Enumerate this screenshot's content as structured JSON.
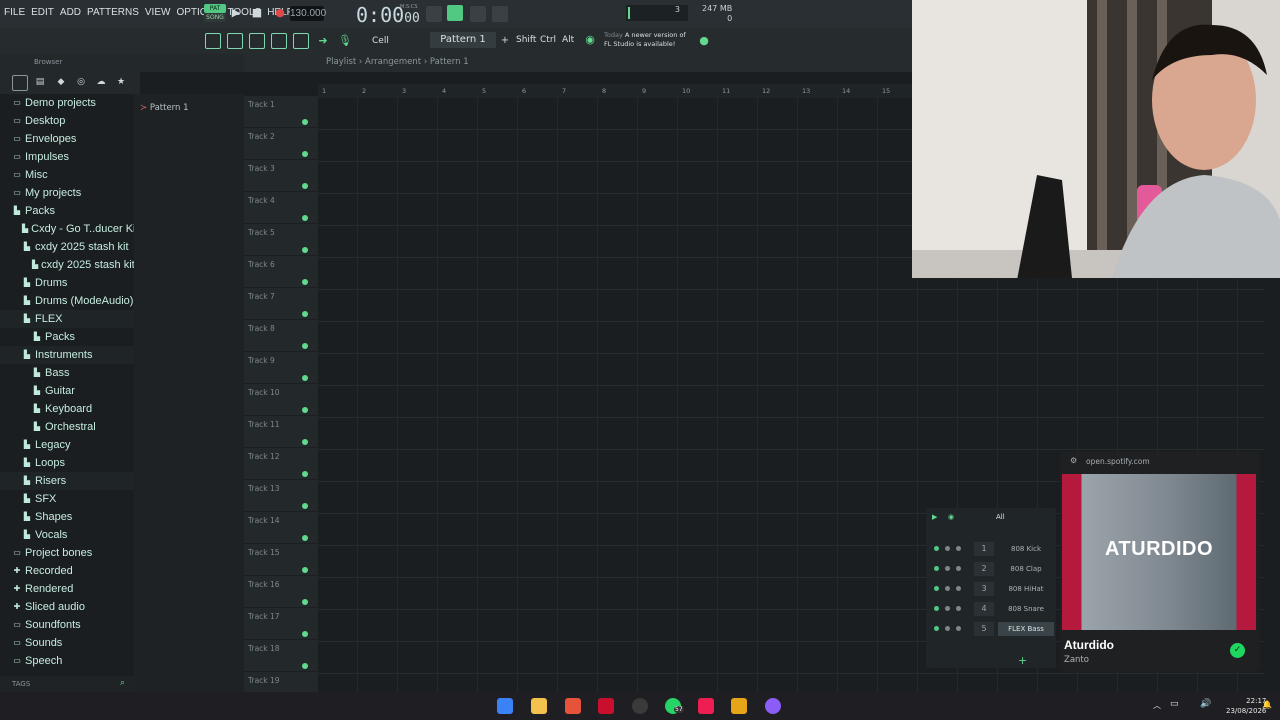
{
  "menu": [
    "FILE",
    "EDIT",
    "ADD",
    "PATTERNS",
    "VIEW",
    "OPTIONS",
    "TOOLS",
    "HELP"
  ],
  "transport": {
    "mode_top": "PAT",
    "mode_bottom": "SONG",
    "tempo": "130.000",
    "time": "0:00",
    "time_ms": "00",
    "time_unit": "M:S:CS"
  },
  "monitor": {
    "cpu": "3",
    "memory": "247 MB",
    "poly": "0"
  },
  "toolbar2": {
    "snap": "Cell",
    "pattern": "Pattern 1",
    "keys": [
      "Shift",
      "Ctrl",
      "Alt"
    ],
    "news_date": "Today",
    "news_line1": "A newer version of",
    "news_line2": "FL Studio is available!"
  },
  "browser": {
    "title": "Browser",
    "items": [
      {
        "label": "Demo projects",
        "icon": "folder-icon",
        "indent": 0
      },
      {
        "label": "Desktop",
        "icon": "folder-icon",
        "indent": 0
      },
      {
        "label": "Envelopes",
        "icon": "folder-icon",
        "indent": 0
      },
      {
        "label": "Impulses",
        "icon": "folder-icon",
        "indent": 0
      },
      {
        "label": "Misc",
        "icon": "folder-icon",
        "indent": 0
      },
      {
        "label": "My projects",
        "icon": "folder-icon",
        "indent": 0
      },
      {
        "label": "Packs",
        "icon": "pack-icon",
        "indent": 0
      },
      {
        "label": "Cxdy - Go T..ducer Kit)",
        "icon": "pack-icon",
        "indent": 1
      },
      {
        "label": "cxdy 2025 stash kit",
        "icon": "pack-icon",
        "indent": 1
      },
      {
        "label": "cxdy 2025 stash kit",
        "icon": "pack-icon",
        "indent": 2
      },
      {
        "label": "Drums",
        "icon": "pack-icon",
        "indent": 1
      },
      {
        "label": "Drums (ModeAudio)",
        "icon": "pack-icon",
        "indent": 1
      },
      {
        "label": "FLEX",
        "icon": "pack-icon",
        "indent": 1
      },
      {
        "label": "Packs",
        "icon": "pack-icon",
        "indent": 2
      },
      {
        "label": "Instruments",
        "icon": "pack-icon",
        "indent": 1
      },
      {
        "label": "Bass",
        "icon": "pack-icon",
        "indent": 2
      },
      {
        "label": "Guitar",
        "icon": "pack-icon",
        "indent": 2
      },
      {
        "label": "Keyboard",
        "icon": "pack-icon",
        "indent": 2
      },
      {
        "label": "Orchestral",
        "icon": "pack-icon",
        "indent": 2
      },
      {
        "label": "Legacy",
        "icon": "pack-icon",
        "indent": 1
      },
      {
        "label": "Loops",
        "icon": "pack-icon",
        "indent": 1
      },
      {
        "label": "Risers",
        "icon": "pack-icon",
        "indent": 1
      },
      {
        "label": "SFX",
        "icon": "pack-icon",
        "indent": 1
      },
      {
        "label": "Shapes",
        "icon": "pack-icon",
        "indent": 1
      },
      {
        "label": "Vocals",
        "icon": "pack-icon",
        "indent": 1
      },
      {
        "label": "Project bones",
        "icon": "folder-icon",
        "indent": 0
      },
      {
        "label": "Recorded",
        "icon": "plus-icon",
        "indent": 0
      },
      {
        "label": "Rendered",
        "icon": "plus-icon",
        "indent": 0
      },
      {
        "label": "Sliced audio",
        "icon": "plus-icon",
        "indent": 0
      },
      {
        "label": "Soundfonts",
        "icon": "folder-icon",
        "indent": 0
      },
      {
        "label": "Sounds",
        "icon": "folder-icon",
        "indent": 0
      },
      {
        "label": "Speech",
        "icon": "folder-icon",
        "indent": 0
      }
    ],
    "tags_label": "TAGS"
  },
  "picker": {
    "pattern": "Pattern 1"
  },
  "playlist": {
    "breadcrumb": "Playlist › Arrangement › Pattern 1",
    "ruler": [
      "1",
      "2",
      "3",
      "4",
      "5",
      "6",
      "7",
      "8",
      "9",
      "10",
      "11",
      "12",
      "13",
      "14",
      "15"
    ],
    "tracks": [
      "Track 1",
      "Track 2",
      "Track 3",
      "Track 4",
      "Track 5",
      "Track 6",
      "Track 7",
      "Track 8",
      "Track 9",
      "Track 10",
      "Track 11",
      "Track 12",
      "Track 13",
      "Track 14",
      "Track 15",
      "Track 16",
      "Track 17",
      "Track 18",
      "Track 19"
    ]
  },
  "channel_rack": {
    "filter": "All",
    "channels": [
      {
        "num": "1",
        "name": "808 Kick"
      },
      {
        "num": "2",
        "name": "808 Clap"
      },
      {
        "num": "3",
        "name": "808 HiHat"
      },
      {
        "num": "4",
        "name": "808 Snare"
      },
      {
        "num": "5",
        "name": "FLEX Bass"
      }
    ]
  },
  "spotify": {
    "url": "open.spotify.com",
    "art_text": "ATURDIDO",
    "title": "Aturdido",
    "artist": "Zanto"
  },
  "taskbar": {
    "time": "22:17",
    "date": "23/08/2026",
    "badge": "57"
  },
  "colors": {
    "accent": "#62d98f",
    "browser_text": "#c6ece1",
    "spotify_green": "#1ed760"
  }
}
